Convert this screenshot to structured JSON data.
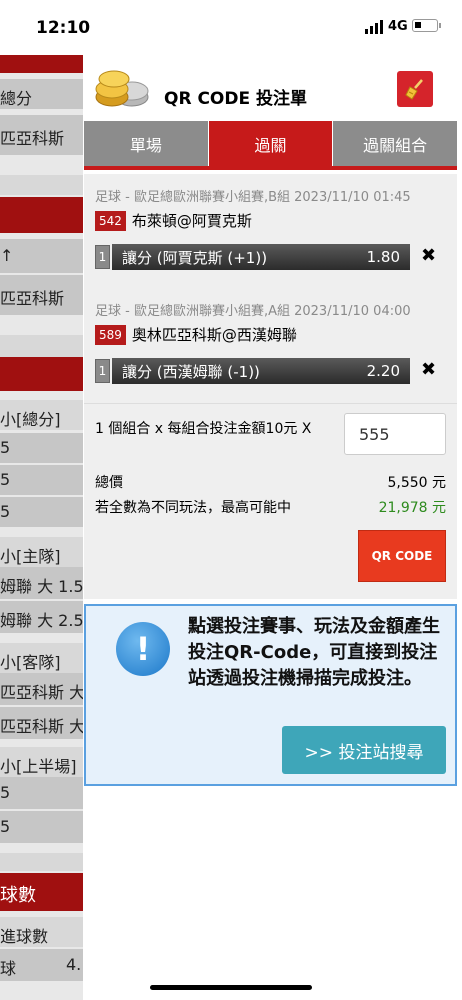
{
  "status_bar": {
    "time": "12:10",
    "network": "4G"
  },
  "background_page": {
    "rows": [
      "總分",
      "匹亞科斯",
      "↑",
      "匹亞科斯",
      "小[總分]",
      "5",
      "5",
      "5",
      "小[主隊]",
      "姆聯 大 1.5",
      "姆聯 大 2.5",
      "小[客隊]",
      "匹亞科斯 大",
      "匹亞科斯 大",
      "小[上半場]",
      "5",
      "5",
      "球數",
      "進球數",
      "球",
      "4."
    ]
  },
  "panel": {
    "title": "QR CODE 投注單",
    "tabs": [
      {
        "label": "單場",
        "active": false
      },
      {
        "label": "過關",
        "active": true
      },
      {
        "label": "過關組合",
        "active": false
      }
    ],
    "bets": [
      {
        "meta": "足球 - 歐足總歐洲聯賽小組賽,B組 2023/11/10 01:45",
        "code": "542",
        "match": "布萊頓@阿賈克斯",
        "index": "1",
        "selection": "讓分 (阿賈克斯 (+1))",
        "odds": "1.80"
      },
      {
        "meta": "足球 - 歐足總歐洲聯賽小組賽,A組 2023/11/10 04:00",
        "code": "589",
        "match": "奧林匹亞科斯@西漢姆聯",
        "index": "1",
        "selection": "讓分 (西漢姆聯 (-1))",
        "odds": "2.20"
      }
    ],
    "stake": {
      "label": "1 個組合 x 每組合投注金額10元 X",
      "value": "555"
    },
    "total_label": "總價",
    "total_value": "5,550 元",
    "maxwin_label": "若全數為不同玩法，最高可能中",
    "maxwin_value": "21,978 元",
    "qr_button": "QR CODE",
    "info_text": "點選投注賽事、玩法及金額產生投注QR-Code，可直接到投注站透過投注機掃描完成投注。",
    "search_button": ">> 投注站搜尋"
  },
  "colors": {
    "brand_red": "#c61a1a",
    "qr_button": "#e83a1f",
    "win_green": "#2e8b1e",
    "info_blue": "#5aa0e0"
  }
}
